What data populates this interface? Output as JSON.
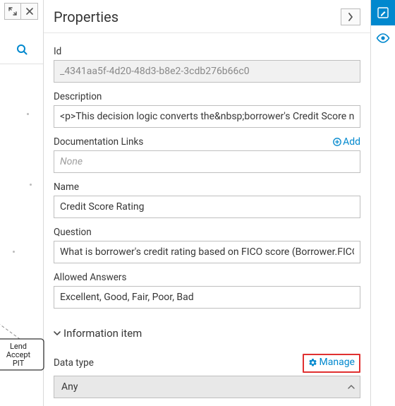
{
  "panel": {
    "title": "Properties",
    "fields": {
      "id_label": "Id",
      "id_value": "_4341aa5f-4d20-48d3-b8e2-3cdb276b66c0",
      "description_label": "Description",
      "description_value": "<p>This decision logic converts the&nbsp;borrower's Credit Score numl",
      "doclinks_label": "Documentation Links",
      "doclinks_add": "Add",
      "doclinks_placeholder": "None",
      "name_label": "Name",
      "name_value": "Credit Score Rating",
      "question_label": "Question",
      "question_value": "What is borrower's credit rating based on FICO score (Borrower.FICOScore)?",
      "answers_label": "Allowed Answers",
      "answers_value": "Excellent, Good, Fair, Poor, Bad"
    },
    "info_section": {
      "title": "Information item",
      "datatype_label": "Data type",
      "manage_label": "Manage",
      "datatype_value": "Any"
    }
  },
  "canvas": {
    "node_lines": [
      "Lend",
      "Accept",
      "PIT"
    ]
  }
}
